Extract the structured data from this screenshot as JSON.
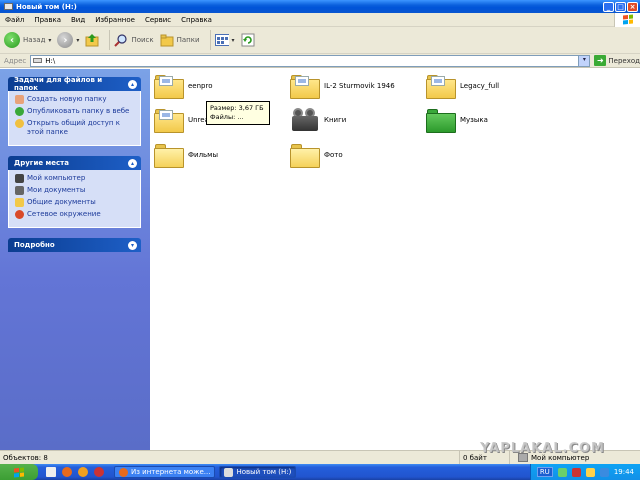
{
  "window": {
    "title": "Новый том (H:)"
  },
  "menu": [
    "Файл",
    "Правка",
    "Вид",
    "Избранное",
    "Сервис",
    "Справка"
  ],
  "toolbar": {
    "back_label": "Назад",
    "search_label": "Поиск",
    "folders_label": "Папки"
  },
  "address": {
    "label": "Адрес",
    "value": "H:\\",
    "go_label": "Переход"
  },
  "tasks_panel": {
    "title": "Задачи для файлов и папок",
    "items": [
      {
        "label": "Создать новую папку",
        "icon": "new-folder-icon"
      },
      {
        "label": "Опубликовать папку в вебе",
        "icon": "web-publish-icon"
      },
      {
        "label": "Открыть общий доступ к этой папке",
        "icon": "share-icon"
      }
    ]
  },
  "places_panel": {
    "title": "Другие места",
    "items": [
      {
        "label": "Мой компьютер",
        "icon": "computer-icon"
      },
      {
        "label": "Мои документы",
        "icon": "documents-icon"
      },
      {
        "label": "Общие документы",
        "icon": "shared-docs-icon"
      },
      {
        "label": "Сетевое окружение",
        "icon": "network-icon"
      }
    ]
  },
  "details_panel": {
    "title": "Подробно"
  },
  "items": [
    {
      "label": "eenpro",
      "type": "folder"
    },
    {
      "label": "IL-2 Sturmovik 1946",
      "type": "folder"
    },
    {
      "label": "Legacy_full",
      "type": "folder"
    },
    {
      "label": "Unrea",
      "type": "folder"
    },
    {
      "label": "Книги",
      "type": "projector"
    },
    {
      "label": "Музыка",
      "type": "green-folder"
    },
    {
      "label": "Фильмы",
      "type": "folder"
    },
    {
      "label": "Фото",
      "type": "folder"
    }
  ],
  "tooltip": {
    "line1": "Размер: 3,67 ГБ",
    "line2": "Файлы: ..."
  },
  "status": {
    "objects": "Объектов: 8",
    "size": "0 байт",
    "location": "Мой компьютер",
    "watermark": "YAPLAKAL.COM"
  },
  "taskbar": {
    "buttons": [
      {
        "label": "Из интернета може...",
        "active": false
      },
      {
        "label": "Новый том (H:)",
        "active": true
      }
    ],
    "lang": "RU",
    "time": "19:44"
  },
  "colors": {
    "titlebar": "#0a5fdc",
    "taskpane": "#6375d6",
    "folder": "#f2c94a",
    "start": "#3c9e34"
  }
}
